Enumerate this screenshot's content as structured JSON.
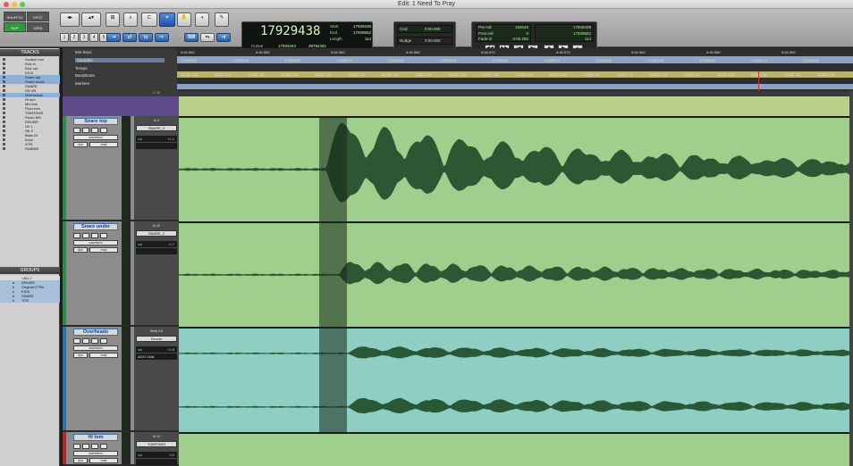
{
  "window": {
    "title": "Edit: 1 Need To Pray"
  },
  "colors": {
    "snare_clip": "#9fcf8d",
    "overhead_clip": "#8fcfc3",
    "tracks_bg": "#c2e0a8",
    "waveform": "#1e4a28",
    "selection": "#2a3f2e"
  },
  "modes": {
    "shuffle": "SHUFFLE",
    "spot": "SPOT",
    "slip": "SLIP",
    "grid": "GRID"
  },
  "zoom_presets": [
    "1",
    "2",
    "3",
    "4",
    "5"
  ],
  "counter": {
    "main": "17929438",
    "cursor_label": "Cursor",
    "cursor_value": "17933444",
    "cursor_value2": "29754451",
    "start_label": "Start",
    "start_value": "17929438",
    "end_label": "End",
    "end_value": "17929552",
    "length_label": "Length",
    "length_value": "114"
  },
  "grid": {
    "grid_label": "Grid",
    "grid_value": "0:00.000",
    "nudge_label": "Nudge",
    "nudge_value": "0:00.000"
  },
  "transport": {
    "preroll_label": "Pre-roll",
    "preroll_value": "194049",
    "postroll_label": "Post-roll",
    "postroll_value": "0",
    "fadein_label": "Fade-in",
    "fadein_value": "0:00.250",
    "start_value": "17929438",
    "end_value": "17929552",
    "length_value": "114",
    "buttons": [
      "◀◀",
      "▶▶",
      "|◀",
      "▶|",
      "■",
      "▶",
      "●"
    ]
  },
  "tracks_panel": {
    "title": "TRACKS",
    "items": [
      {
        "name": "Scratch vox",
        "selected": false
      },
      {
        "name": "Kick in",
        "selected": false
      },
      {
        "name": "Kick out",
        "selected": false
      },
      {
        "name": "KICK",
        "selected": false
      },
      {
        "name": "Snare top",
        "selected": true
      },
      {
        "name": "Snare under",
        "selected": true
      },
      {
        "name": "SNARE",
        "selected": false
      },
      {
        "name": "SN VB",
        "selected": false
      },
      {
        "name": "Overheads",
        "selected": true
      },
      {
        "name": "Hi tom",
        "selected": false
      },
      {
        "name": "Mid tom",
        "selected": false
      },
      {
        "name": "Floor tom",
        "selected": false
      },
      {
        "name": "TOMTOMS",
        "selected": false
      },
      {
        "name": "Room MS",
        "selected": false
      },
      {
        "name": "DRUMS",
        "selected": false
      },
      {
        "name": "Gtr 1",
        "selected": false
      },
      {
        "name": "Gtr 2",
        "selected": false
      },
      {
        "name": "Bass DI",
        "selected": false
      },
      {
        "name": "Keys",
        "selected": false
      },
      {
        "name": "GTR",
        "selected": false
      },
      {
        "name": "SUBMIX",
        "selected": false
      }
    ]
  },
  "groups_panel": {
    "title": "GROUPS",
    "items": [
      {
        "id": "",
        "name": "<ALL>"
      },
      {
        "id": "a",
        "name": "DRUMS"
      },
      {
        "id": "b",
        "name": "Original OTRs"
      },
      {
        "id": "c",
        "name": "KICK"
      },
      {
        "id": "d",
        "name": "SNARE"
      },
      {
        "id": "h",
        "name": "TOS"
      }
    ]
  },
  "rulers": {
    "labels": [
      "Min:Secs",
      "Samples",
      "Tempo",
      "Bars|Beats",
      "Markers"
    ],
    "minsecs": [
      "6:46.550",
      "6:46.555",
      "6:46.560",
      "6:46.565",
      "6:46.570",
      "6:46.575",
      "6:46.580",
      "6:46.585",
      "6:46.590",
      "6:46.595"
    ],
    "samples": [
      "17929900",
      "17929925",
      "17929950",
      "17929975",
      "17930000",
      "17930025",
      "17930050",
      "17930075",
      "17930100",
      "17930125",
      "17930150",
      "17930175",
      "17930200"
    ],
    "barsbeats": [
      "204|3| 105",
      "204|3| 110",
      "204|3| 115",
      "204|3| 120",
      "204|3| 125",
      "204|3| 130",
      "204|3| 135",
      "204|3| 140",
      "204|3| 145",
      "204|3| 150",
      "204|3| 155",
      "204|3| 160",
      "204|3| 165",
      "204|3| 170",
      "204|3| 175",
      "204|3| 180",
      "204|3| 185",
      "204|3| 190",
      "204|3| 195",
      "204|3| 200"
    ]
  },
  "input_header": "I / O",
  "tracks": [
    {
      "name": "Snare top",
      "input": "In 3",
      "output": "SNARE_2",
      "view": "waveform",
      "dyn": "dyn",
      "read": "read",
      "vol_label": "vol",
      "vol_value": "+1.1",
      "pan": ""
    },
    {
      "name": "Snare under",
      "input": "In 10",
      "output": "SNARE_2",
      "view": "waveform",
      "dyn": "dyn",
      "read": "read",
      "vol_label": "vol",
      "vol_value": "-0.7",
      "pan": ""
    },
    {
      "name": "Overheads",
      "input": "Send 4-5",
      "output": "Drums",
      "view": "waveform",
      "dyn": "dyn",
      "read": "read",
      "vol_label": "vol",
      "vol_value": "+3.8",
      "pan": "◂100   100▸"
    },
    {
      "name": "Hi tom",
      "input": "In 12",
      "output": "TOMTOMS",
      "view": "waveform",
      "dyn": "dyn",
      "read": "read",
      "vol_label": "vol",
      "vol_value": "0.0",
      "pan": ""
    }
  ]
}
